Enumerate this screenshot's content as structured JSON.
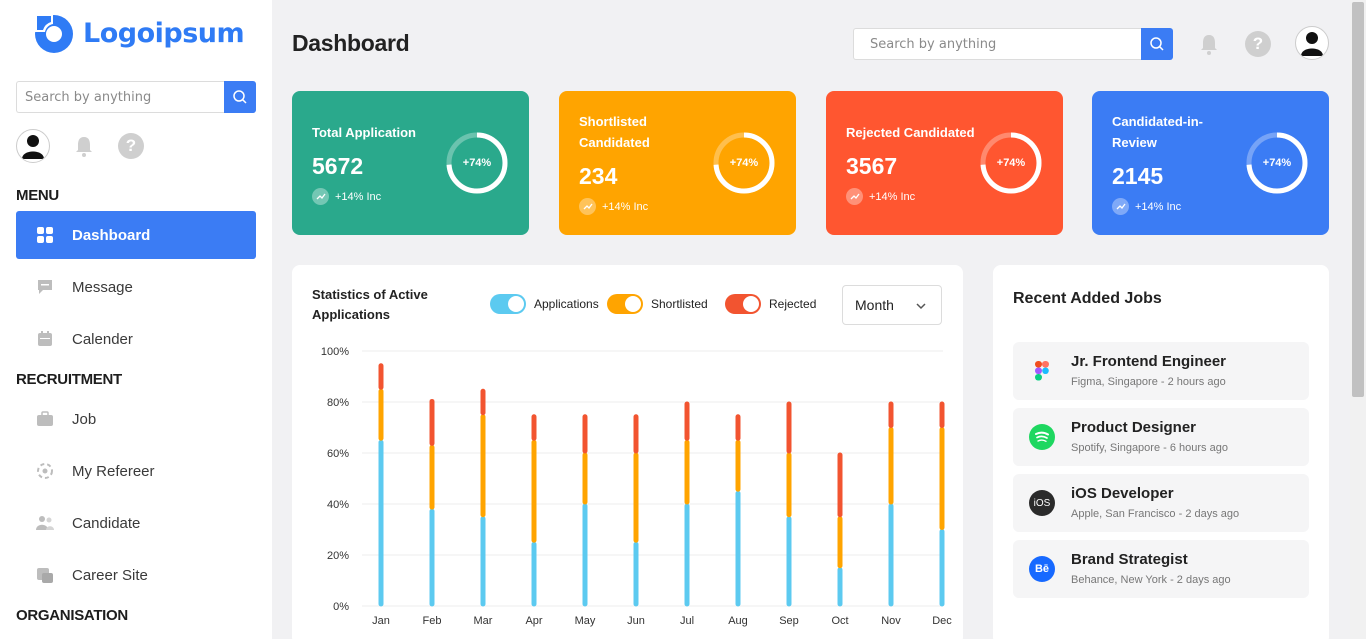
{
  "brand": {
    "name": "Logoipsum",
    "color": "#2f7bf5"
  },
  "sidebar": {
    "search_placeholder": "Search by anything",
    "sections": {
      "menu": "MENU",
      "recruitment": "RECRUITMENT",
      "organisation": "ORGANISATION"
    },
    "items": [
      {
        "label": "Dashboard",
        "icon": "grid-icon",
        "active": true
      },
      {
        "label": "Message",
        "icon": "message-icon"
      },
      {
        "label": "Calender",
        "icon": "calendar-icon"
      },
      {
        "label": "Job",
        "icon": "briefcase-icon"
      },
      {
        "label": "My Refereer",
        "icon": "referral-icon"
      },
      {
        "label": "Candidate",
        "icon": "users-icon"
      },
      {
        "label": "Career Site",
        "icon": "career-site-icon"
      }
    ]
  },
  "header": {
    "title": "Dashboard",
    "search_placeholder": "Search by anything"
  },
  "cards": [
    {
      "label": "Total Application",
      "value": "5672",
      "ring": "+74%",
      "inc": "+14% Inc",
      "color": "#2aa98c"
    },
    {
      "label": "Shortlisted Candidated",
      "value": "234",
      "ring": "+74%",
      "inc": "+14% Inc",
      "color": "#ffa400"
    },
    {
      "label": "Rejected Candidated",
      "value": "3567",
      "ring": "+74%",
      "inc": "+14% Inc",
      "color": "#ff5630"
    },
    {
      "label": "Candidated-in-Review",
      "value": "2145",
      "ring": "+74%",
      "inc": "+14% Inc",
      "color": "#3b7cf4"
    }
  ],
  "chart_panel": {
    "title": "Statistics of Active Applications",
    "legend": [
      "Applications",
      "Shortlisted",
      "Rejected"
    ],
    "period": "Month"
  },
  "chart_data": {
    "type": "bar",
    "stacked": true,
    "categories": [
      "Jan",
      "Feb",
      "Mar",
      "Apr",
      "May",
      "Jun",
      "Jul",
      "Aug",
      "Sep",
      "Oct",
      "Nov",
      "Dec"
    ],
    "series": [
      {
        "name": "Applications",
        "color": "#5ccaf0",
        "values": [
          65,
          38,
          35,
          25,
          40,
          25,
          40,
          45,
          35,
          15,
          40,
          30
        ]
      },
      {
        "name": "Shortlisted",
        "color": "#ffa400",
        "values": [
          20,
          25,
          40,
          40,
          20,
          35,
          25,
          20,
          25,
          20,
          30,
          40
        ]
      },
      {
        "name": "Rejected",
        "color": "#f25430",
        "values": [
          10,
          18,
          10,
          10,
          15,
          15,
          15,
          10,
          20,
          25,
          10,
          10
        ]
      }
    ],
    "yticks": [
      "0%",
      "20%",
      "40%",
      "60%",
      "80%",
      "100%"
    ],
    "ylim": [
      0,
      100
    ],
    "grid": true
  },
  "jobs": {
    "title": "Recent Added Jobs",
    "items": [
      {
        "title": "Jr. Frontend Engineer",
        "sub": "Figma, Singapore - 2 hours ago",
        "icon": "figma-icon"
      },
      {
        "title": "Product Designer",
        "sub": "Spotify, Singapore - 6 hours ago",
        "icon": "spotify-icon"
      },
      {
        "title": "iOS Developer",
        "sub": "Apple, San Francisco - 2 days ago",
        "icon": "ios-icon",
        "icon_text": "iOS"
      },
      {
        "title": "Brand Strategist",
        "sub": "Behance, New York - 2 days ago",
        "icon": "behance-icon",
        "icon_text": "Bē"
      }
    ]
  }
}
